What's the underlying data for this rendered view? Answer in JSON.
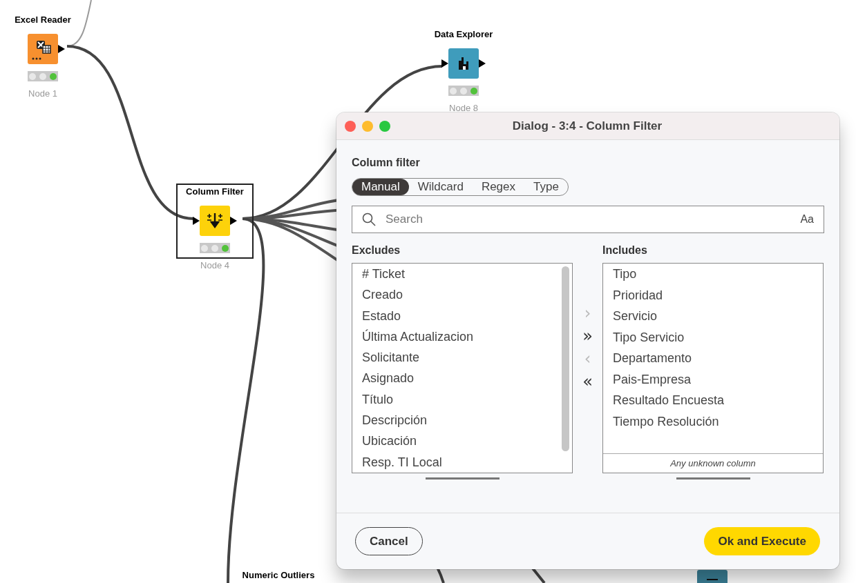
{
  "canvas": {
    "nodes": [
      {
        "kind": "excel",
        "title": "Excel Reader",
        "label": "Node 1",
        "executed": true,
        "selected": false
      },
      {
        "kind": "filter",
        "title": "Column Filter",
        "label": "Node 4",
        "executed": true,
        "selected": true
      },
      {
        "kind": "explorer",
        "title": "Data Explorer",
        "label": "Node 8",
        "executed": true,
        "selected": false
      },
      {
        "kind": "outliers",
        "title": "Numeric Outliers",
        "selected": false
      },
      {
        "kind": "view",
        "selected": false
      }
    ]
  },
  "dialog": {
    "title": "Dialog - 3:4 - Column Filter",
    "section_label": "Column filter",
    "modes": [
      {
        "label": "Manual",
        "selected": true
      },
      {
        "label": "Wildcard",
        "selected": false
      },
      {
        "label": "Regex",
        "selected": false
      },
      {
        "label": "Type",
        "selected": false
      }
    ],
    "search": {
      "placeholder": "Search",
      "case_toggle": "Aa"
    },
    "excludes": {
      "label": "Excludes",
      "items": [
        "# Ticket",
        "Creado",
        "Estado",
        "Última Actualizacion",
        "Solicitante",
        "Asignado",
        "Título",
        "Descripción",
        "Ubicación",
        "Resp. TI Local"
      ]
    },
    "includes": {
      "label": "Includes",
      "items": [
        "Tipo",
        "Prioridad",
        "Servicio",
        "Tipo Servicio",
        "Departamento",
        "Pais-Empresa",
        "Resultado Encuesta",
        "Tiempo Resolución"
      ],
      "footer": "Any unknown column"
    },
    "move_buttons": [
      {
        "label": "›",
        "disabled": true
      },
      {
        "label": "»",
        "disabled": false
      },
      {
        "label": "‹",
        "disabled": true
      },
      {
        "label": "«",
        "disabled": false
      }
    ],
    "buttons": [
      {
        "label": "Cancel",
        "kind": "secondary"
      },
      {
        "label": "Ok and Execute",
        "kind": "primary"
      }
    ]
  }
}
